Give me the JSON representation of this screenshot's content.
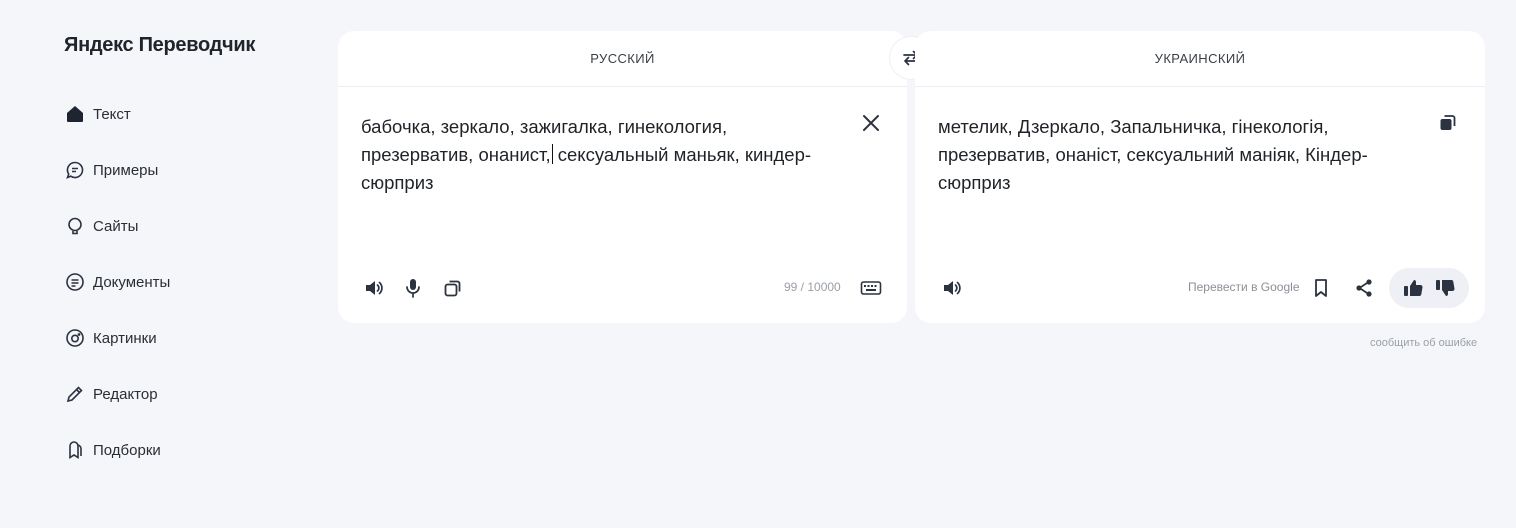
{
  "app": {
    "title": "Яндекс Переводчик"
  },
  "sidebar": {
    "items": [
      {
        "label": "Текст",
        "icon": "home-icon"
      },
      {
        "label": "Примеры",
        "icon": "chat-icon"
      },
      {
        "label": "Сайты",
        "icon": "bulb-icon"
      },
      {
        "label": "Документы",
        "icon": "document-icon"
      },
      {
        "label": "Картинки",
        "icon": "camera-icon"
      },
      {
        "label": "Редактор",
        "icon": "pencil-icon"
      },
      {
        "label": "Подборки",
        "icon": "collection-icon"
      }
    ]
  },
  "source": {
    "language": "РУССКИЙ",
    "text_before_caret": "бабочка, зеркало, зажигалка, гинекология, презерватив, онанист,",
    "text_after_caret": " сексуальный маньяк, киндер-сюрприз",
    "counter": "99 / 10000"
  },
  "target": {
    "language": "УКРАИНСКИЙ",
    "text": "метелик, Дзеркало, Запальничка, гінекологія, презерватив, онаніст, сексуальний маніяк, Кіндер-сюрприз",
    "google_label": "Перевести в Google"
  },
  "footer": {
    "report_label": "сообщить об ошибке"
  },
  "colors": {
    "background": "#f5f6fa",
    "panel": "#ffffff",
    "icon": "#2b3240"
  }
}
